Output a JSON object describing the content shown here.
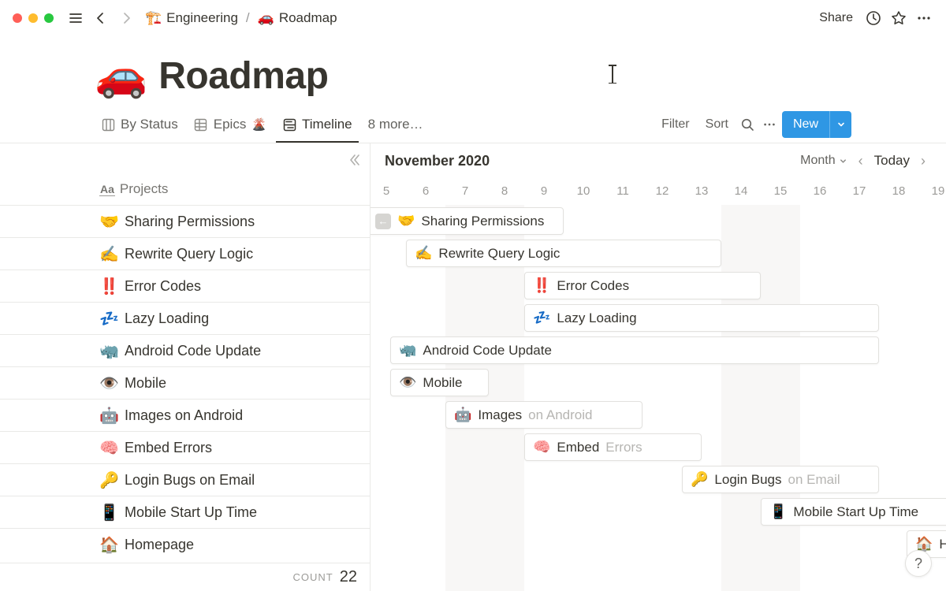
{
  "topbar": {
    "breadcrumb": [
      {
        "icon": "🏗️",
        "label": "Engineering"
      },
      {
        "icon": "🚗",
        "label": "Roadmap"
      }
    ],
    "share": "Share"
  },
  "page": {
    "icon": "🚗",
    "title": "Roadmap"
  },
  "views": {
    "tabs": [
      {
        "icon": "board",
        "label": "By Status"
      },
      {
        "icon": "table",
        "label": "Epics",
        "suffix_emoji": "🌋"
      },
      {
        "icon": "timeline",
        "label": "Timeline",
        "active": true
      },
      {
        "icon": "",
        "label": "8 more…"
      }
    ],
    "filter": "Filter",
    "sort": "Sort",
    "new_label": "New"
  },
  "timeline": {
    "projects_header": "Projects",
    "month_label": "November 2020",
    "scale": "Month",
    "today": "Today",
    "day_start": 5,
    "day_end": 19,
    "day_width": 50,
    "left_origin": 20,
    "weekends": [
      {
        "start": 7,
        "end": 8
      },
      {
        "start": 14,
        "end": 15
      }
    ],
    "rows": [
      {
        "emoji": "🤝",
        "label": "Sharing Permissions",
        "bar": {
          "start": 5.0,
          "width": 5.0,
          "left_arrow": true,
          "ghost_after": 2
        }
      },
      {
        "emoji": "✍️",
        "label": "Rewrite Query Logic",
        "bar": {
          "start": 6.0,
          "width": 8.0
        }
      },
      {
        "emoji": "‼️",
        "label": "Error Codes",
        "bar": {
          "start": 9.0,
          "width": 6.0
        }
      },
      {
        "emoji": "💤",
        "label": "Lazy Loading",
        "bar": {
          "start": 9.0,
          "width": 9.0
        }
      },
      {
        "emoji": "🦏",
        "label": "Android Code Update",
        "bar": {
          "start": 5.6,
          "width": 12.4
        }
      },
      {
        "emoji": "👁️",
        "label": "Mobile",
        "bar": {
          "start": 5.6,
          "width": 2.5
        }
      },
      {
        "emoji": "🤖",
        "label": "Images on Android",
        "bar": {
          "start": 7.0,
          "width": 5.0,
          "ghost_after": 1
        }
      },
      {
        "emoji": "🧠",
        "label": "Embed Errors",
        "bar": {
          "start": 9.0,
          "width": 4.5,
          "ghost_after": 1
        }
      },
      {
        "emoji": "🔑",
        "label": "Login Bugs on Email",
        "bar": {
          "start": 13.0,
          "width": 5.0,
          "ghost_after": 2
        }
      },
      {
        "emoji": "📱",
        "label": "Mobile Start Up Time",
        "bar": {
          "start": 15.0,
          "width": 5.0
        }
      },
      {
        "emoji": "🏠",
        "label": "Homepage",
        "bar": {
          "start": 18.7,
          "width": 1.5
        }
      }
    ],
    "count_label": "COUNT",
    "count_value": "22"
  }
}
